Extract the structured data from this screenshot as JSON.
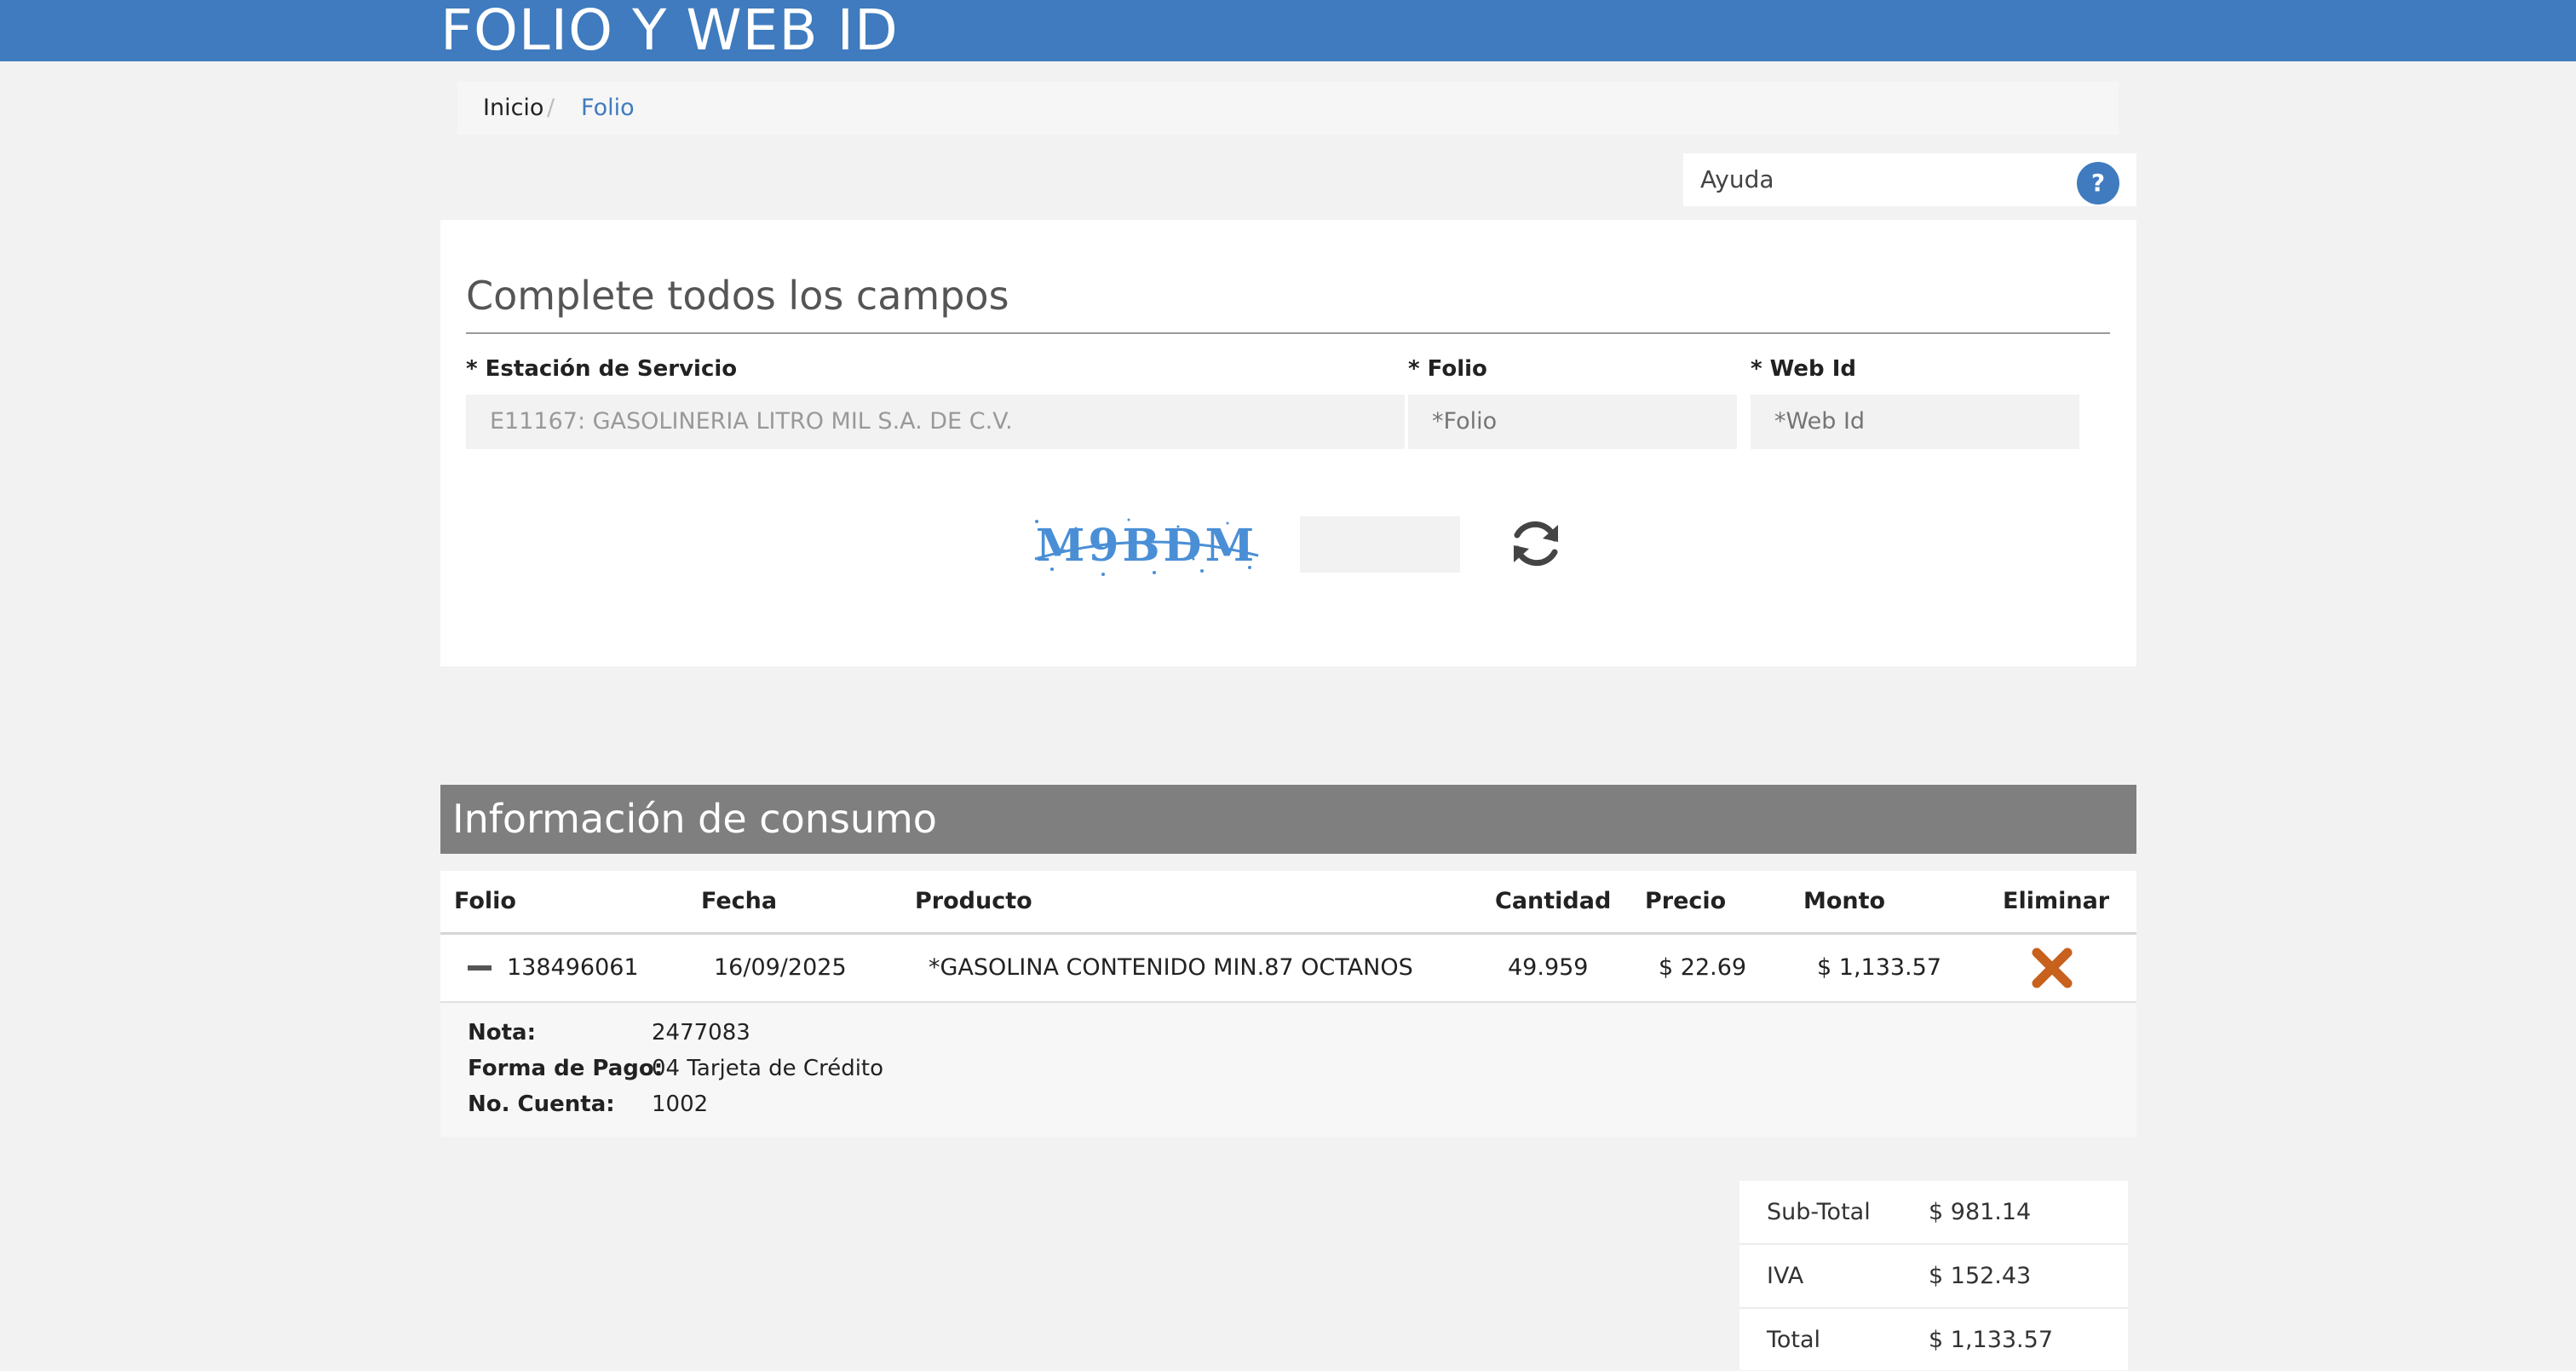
{
  "header": {
    "title": "FOLIO Y WEB ID"
  },
  "breadcrumb": {
    "home": "Inicio",
    "separator": "/",
    "current": "Folio"
  },
  "help": {
    "label": "Ayuda",
    "icon": "?"
  },
  "form": {
    "heading": "Complete todos los campos",
    "estacion": {
      "label": "* Estación de Servicio",
      "value": "E11167: GASOLINERIA LITRO MIL S.A. DE C.V."
    },
    "folio": {
      "label": "* Folio",
      "placeholder": "*Folio"
    },
    "webid": {
      "label": "* Web Id",
      "placeholder": "*Web Id"
    },
    "captcha": {
      "text": "M9BDM"
    }
  },
  "consumo": {
    "title": "Información de consumo",
    "columns": [
      "Folio",
      "Fecha",
      "Producto",
      "Cantidad",
      "Precio",
      "Monto",
      "Eliminar"
    ],
    "rows": [
      {
        "folio": "138496061",
        "fecha": "16/09/2025",
        "producto": "*GASOLINA CONTENIDO MIN.87 OCTANOS",
        "cantidad": "49.959",
        "precio": "$ 22.69",
        "monto": "$ 1,133.57"
      }
    ],
    "details": {
      "nota_label": "Nota:",
      "nota": "2477083",
      "pago_label": "Forma de Pago:",
      "pago": "04 Tarjeta de Crédito",
      "cuenta_label": "No. Cuenta:",
      "cuenta": "1002"
    }
  },
  "totals": {
    "subtotal_label": "Sub-Total",
    "subtotal": "$ 981.14",
    "iva_label": "IVA",
    "iva": "$ 152.43",
    "total_label": "Total",
    "total": "$ 1,133.57"
  },
  "colors": {
    "brand": "#3f7bbe",
    "section_header": "#7f7f7f",
    "delete": "#c8601e"
  },
  "icons": {
    "help": "question-icon",
    "refresh": "refresh-icon",
    "delete": "close-icon",
    "toggle": "minus-icon"
  }
}
